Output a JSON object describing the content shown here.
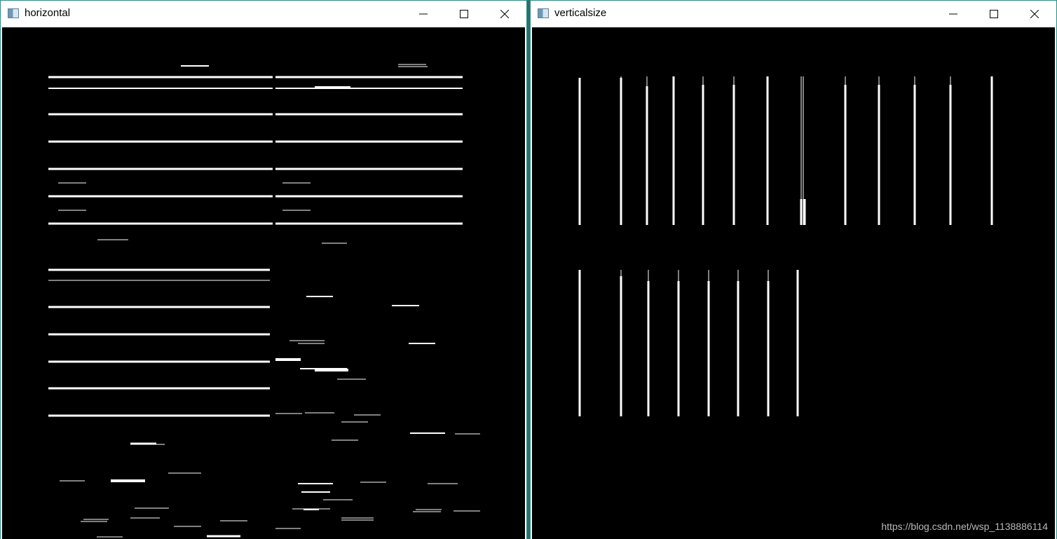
{
  "windows": [
    {
      "title": "horizontal",
      "icon": "opencv-window-icon",
      "controls": [
        "minimize-icon",
        "maximize-icon",
        "close-icon"
      ],
      "content": "white horizontal line segments on black background"
    },
    {
      "title": "verticalsize",
      "icon": "opencv-window-icon",
      "controls": [
        "minimize-icon",
        "maximize-icon",
        "close-icon"
      ],
      "content": "white vertical line segments on black background"
    }
  ],
  "watermark": "https://blog.csdn.net/wsp_1138886114",
  "colors": {
    "canvas": "#000000",
    "lines": "#ffffff",
    "titlebar": "#ffffff",
    "border": "#2b8a84"
  }
}
